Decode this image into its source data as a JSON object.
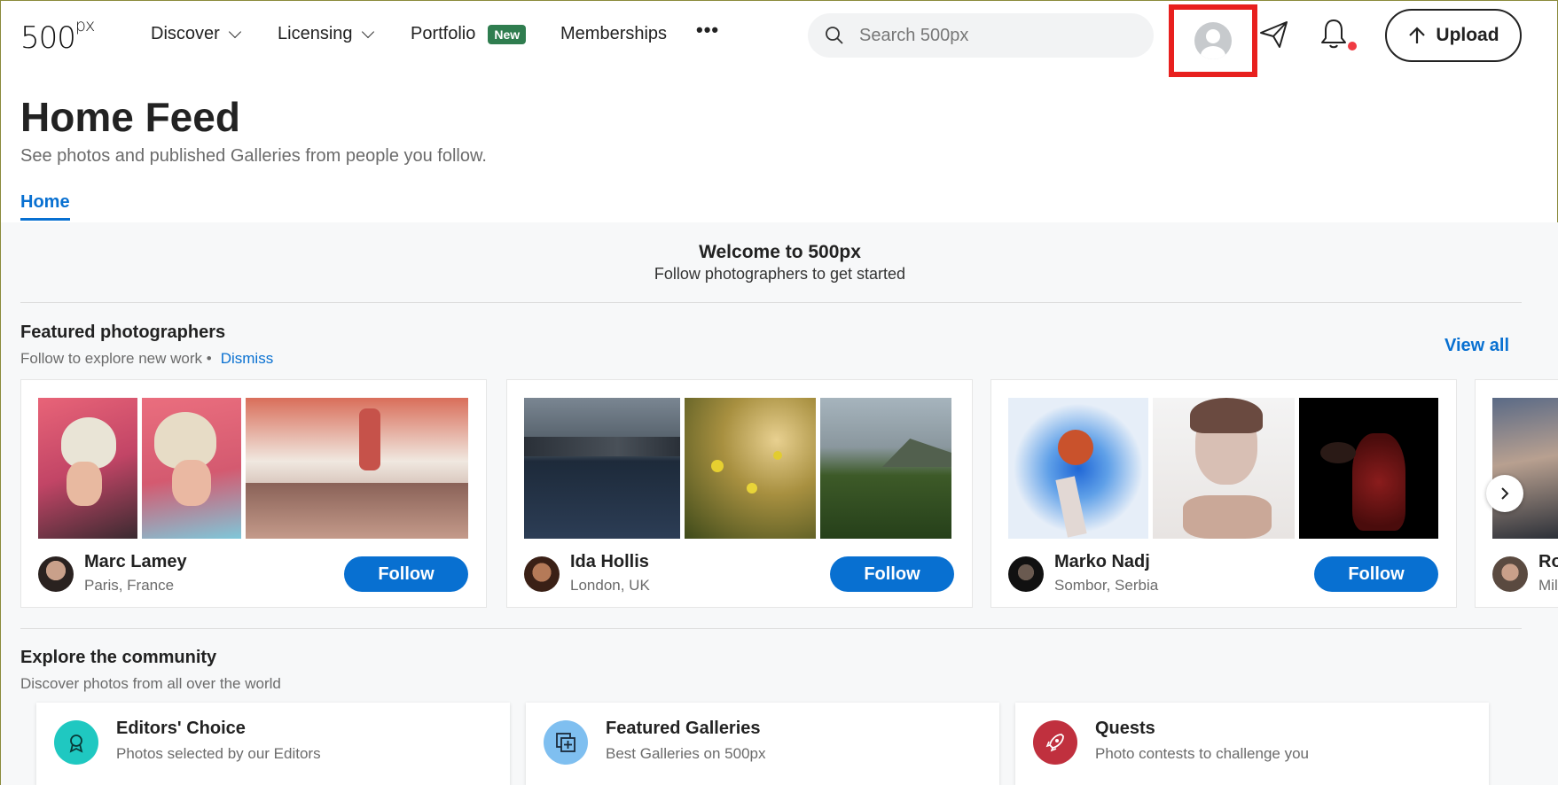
{
  "nav": {
    "logo": "500",
    "logo_sup": "px",
    "items": [
      {
        "label": "Discover"
      },
      {
        "label": "Licensing"
      },
      {
        "label": "Portfolio",
        "badge": "New"
      },
      {
        "label": "Memberships"
      }
    ],
    "more": "•••",
    "search_placeholder": "Search 500px",
    "upload_label": "Upload"
  },
  "header": {
    "title": "Home Feed",
    "subtitle": "See photos and published Galleries from people you follow.",
    "tab": "Home"
  },
  "welcome": {
    "title": "Welcome to 500px",
    "subtitle": "Follow photographers to get started"
  },
  "featured": {
    "title": "Featured photographers",
    "subtitle": "Follow to explore new work •",
    "dismiss": "Dismiss",
    "view_all": "View all",
    "follow_label": "Follow",
    "photographers": [
      {
        "name": "Marc Lamey",
        "location": "Paris, France"
      },
      {
        "name": "Ida Hollis",
        "location": "London, UK"
      },
      {
        "name": "Marko Nadj",
        "location": "Sombor, Serbia"
      },
      {
        "name": "Ro",
        "location": "Mil"
      }
    ]
  },
  "explore": {
    "title": "Explore the community",
    "subtitle": "Discover photos from all over the world",
    "cards": [
      {
        "title": "Editors' Choice",
        "subtitle": "Photos selected by our Editors",
        "color": "#1fc8c1"
      },
      {
        "title": "Featured Galleries",
        "subtitle": "Best Galleries on 500px",
        "color": "#7fbff0"
      },
      {
        "title": "Quests",
        "subtitle": "Photo contests to challenge you",
        "color": "#c0303e"
      }
    ]
  },
  "colors": {
    "accent": "#0870d1",
    "badge": "#2f7d4f",
    "highlight": "#e8201e"
  }
}
